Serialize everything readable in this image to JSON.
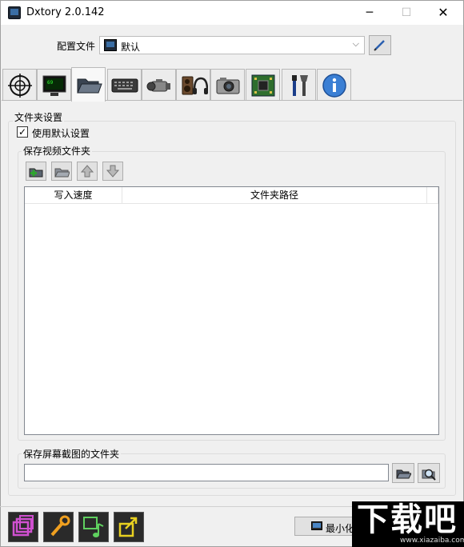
{
  "window": {
    "title": "Dxtory 2.0.142",
    "controls": {
      "minimize": "─",
      "maximize": "☐",
      "close": "✕"
    }
  },
  "profile": {
    "label": "配置文件",
    "selected": "默认",
    "edit_icon": "pencil-icon"
  },
  "tabs": [
    {
      "icon": "crosshair-icon",
      "active": false
    },
    {
      "icon": "monitor-icon",
      "active": false
    },
    {
      "icon": "folder-icon",
      "active": true
    },
    {
      "icon": "keyboard-icon",
      "active": false
    },
    {
      "icon": "video-camera-icon",
      "active": false
    },
    {
      "icon": "audio-icon",
      "active": false
    },
    {
      "icon": "photo-camera-icon",
      "active": false
    },
    {
      "icon": "chip-icon",
      "active": false
    },
    {
      "icon": "tools-icon",
      "active": false
    },
    {
      "icon": "info-icon",
      "active": false
    }
  ],
  "folder_settings": {
    "group_title": "文件夹设置",
    "use_default_label": "使用默认设置",
    "use_default_checked": true,
    "video_folder": {
      "group_title": "保存视频文件夹",
      "toolbar": [
        "add-folder-icon",
        "remove-folder-icon",
        "arrow-up-icon",
        "arrow-down-icon"
      ],
      "columns": [
        "写入速度",
        "文件夹路径"
      ],
      "rows": []
    },
    "screenshot_folder": {
      "group_title": "保存屏幕截图的文件夹",
      "path_value": "",
      "browse_icon": "open-folder-icon",
      "search_icon": "magnifier-icon"
    }
  },
  "bottom": {
    "buttons": [
      "overlay-icon",
      "wrench-icon",
      "music-icon",
      "export-icon"
    ],
    "minimize_label": "最小化"
  },
  "watermark": {
    "big": "下载吧",
    "small": "www.xiazaiba.com"
  },
  "colors": {
    "accent_purple": "#c040c0",
    "accent_orange": "#f0a020",
    "accent_green": "#5fd05f",
    "accent_yellow": "#e8d020"
  }
}
